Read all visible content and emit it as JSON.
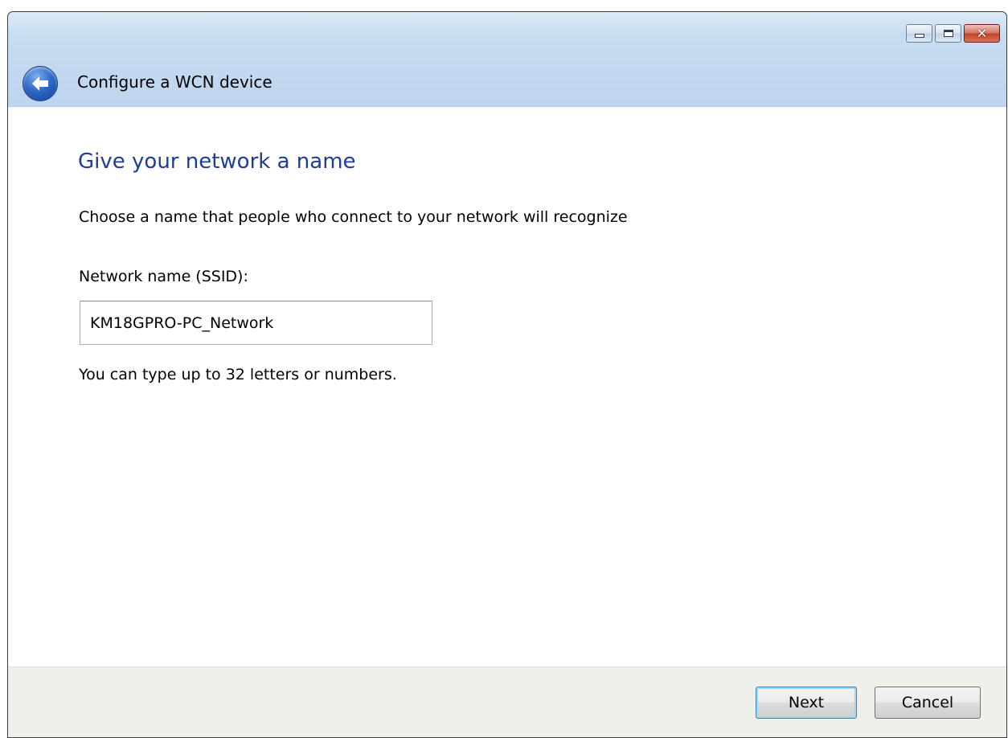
{
  "window": {
    "title": "Configure a WCN device",
    "controls": {
      "minimize": "minimize-icon",
      "maximize": "maximize-icon",
      "close": "close-icon"
    },
    "back_icon": "back-arrow-icon"
  },
  "page": {
    "heading": "Give your network a name",
    "instruction": "Choose a name that people who connect to your network will recognize",
    "ssid_label": "Network name (SSID):",
    "ssid_value": "KM18GPRO-PC_Network",
    "hint": "You can type up to 32 letters or numbers."
  },
  "footer": {
    "next_label": "Next",
    "cancel_label": "Cancel"
  },
  "colors": {
    "heading": "#1f3d98",
    "chrome": "#c7dcf1",
    "footer": "#f0f0ea"
  }
}
